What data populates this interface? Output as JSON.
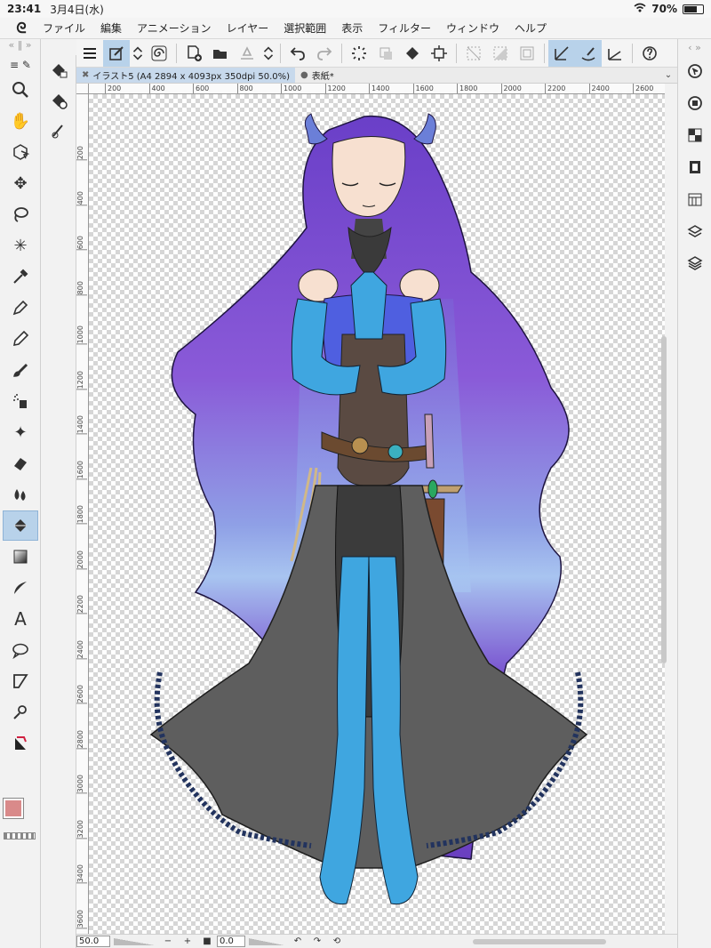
{
  "status": {
    "time": "23:41",
    "date": "3月4日(水)",
    "battery": "70%",
    "battery_level": 0.7
  },
  "menu": {
    "items": [
      "ファイル",
      "編集",
      "アニメーション",
      "レイヤー",
      "選択範囲",
      "表示",
      "フィルター",
      "ウィンドウ",
      "ヘルプ"
    ]
  },
  "tabs": [
    {
      "label": "イラスト5 (A4 2894 x 4093px 350dpi 50.0%)",
      "close": "✖",
      "active": true
    },
    {
      "label": "表紙*",
      "close": "●",
      "active": false
    }
  ],
  "ruler": {
    "h_ticks": [
      "200",
      "400",
      "600",
      "800",
      "1000",
      "1200",
      "1400",
      "1600",
      "1800",
      "2000",
      "2200",
      "2400",
      "2600"
    ],
    "v_ticks": [
      "200",
      "400",
      "600",
      "800",
      "1000",
      "1200",
      "1400",
      "1600",
      "1800",
      "2000",
      "2200",
      "2400",
      "2600",
      "2800",
      "3000",
      "3200",
      "3400",
      "3600"
    ]
  },
  "bottom": {
    "zoom": "50.0",
    "minus": "−",
    "plus": "+",
    "stop": "■",
    "angle": "0.0",
    "rotate_left": "↶",
    "rotate_right": "↷",
    "reset": "⟲"
  },
  "colors": {
    "main": "#d98a8a",
    "sub": "#d4b98a",
    "accent": "#b8d2ea"
  },
  "icons": {
    "left_tools": [
      "zoom-icon",
      "hand-icon",
      "object-select-icon",
      "move-icon",
      "lasso-icon",
      "magic-wand-icon",
      "eyedropper-icon",
      "pen-icon",
      "pencil-icon",
      "brush-icon",
      "airbrush-icon",
      "decoration-icon",
      "eraser-icon",
      "blend-icon",
      "fill-icon",
      "gradient-icon",
      "figure-icon",
      "text-icon",
      "balloon-icon",
      "frame-icon",
      "correct-line-icon",
      "ruler-icon"
    ],
    "right_panel": [
      "navigator-icon",
      "sub-view-icon",
      "layers-grid-icon",
      "animation-icon",
      "material-icon",
      "layer-props-icon",
      "layers-icon"
    ]
  }
}
